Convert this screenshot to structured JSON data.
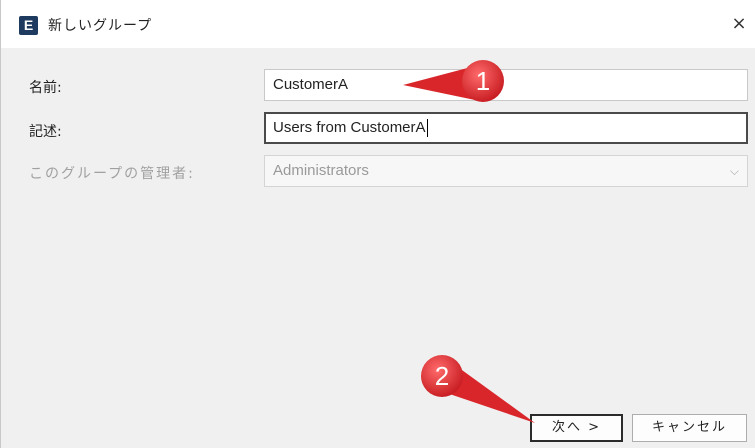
{
  "window": {
    "title": "新しいグループ",
    "app_icon_letter": "E",
    "close_glyph": "×"
  },
  "form": {
    "name": {
      "label": "名前:",
      "value": "CustomerA"
    },
    "description": {
      "label": "記述:",
      "value": "Users from CustomerA"
    },
    "manager": {
      "label": "このグループの管理者:",
      "value": "Administrators",
      "chevron": "⌵"
    }
  },
  "buttons": {
    "next": "次へ >",
    "cancel": "キャンセル"
  },
  "annotations": [
    {
      "number": "1",
      "color": "#e8353a"
    },
    {
      "number": "2",
      "color": "#e8353a"
    }
  ]
}
